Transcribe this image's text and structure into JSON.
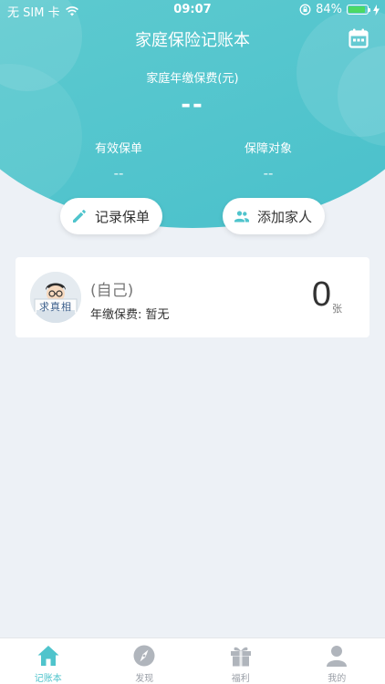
{
  "status_bar": {
    "carrier": "无 SIM 卡",
    "time": "09:07",
    "battery": "84%",
    "battery_level": 0.84
  },
  "header": {
    "title": "家庭保险记账本",
    "premium_label": "家庭年缴保费(元)",
    "premium_value": "--",
    "stats": [
      {
        "label": "有效保单",
        "value": "--"
      },
      {
        "label": "保障对象",
        "value": "--"
      }
    ]
  },
  "actions": {
    "record_policy": "记录保单",
    "add_family": "添加家人"
  },
  "member_card": {
    "avatar_text": "求真相",
    "name": "(自己)",
    "annual_premium": "年缴保费: 暂无",
    "policy_count": "0",
    "policy_unit": "张"
  },
  "tabbar": {
    "tabs": [
      {
        "label": "记账本",
        "active": true,
        "icon": "home-icon"
      },
      {
        "label": "发现",
        "active": false,
        "icon": "compass-icon"
      },
      {
        "label": "福利",
        "active": false,
        "icon": "gift-icon"
      },
      {
        "label": "我的",
        "active": false,
        "icon": "user-icon"
      }
    ]
  },
  "colors": {
    "accent": "#4fc4cc",
    "header_gradient_start": "#7ed7d9",
    "header_gradient_end": "#49c0cb",
    "background": "#edf1f6",
    "inactive_tab": "#9a9fa7"
  }
}
